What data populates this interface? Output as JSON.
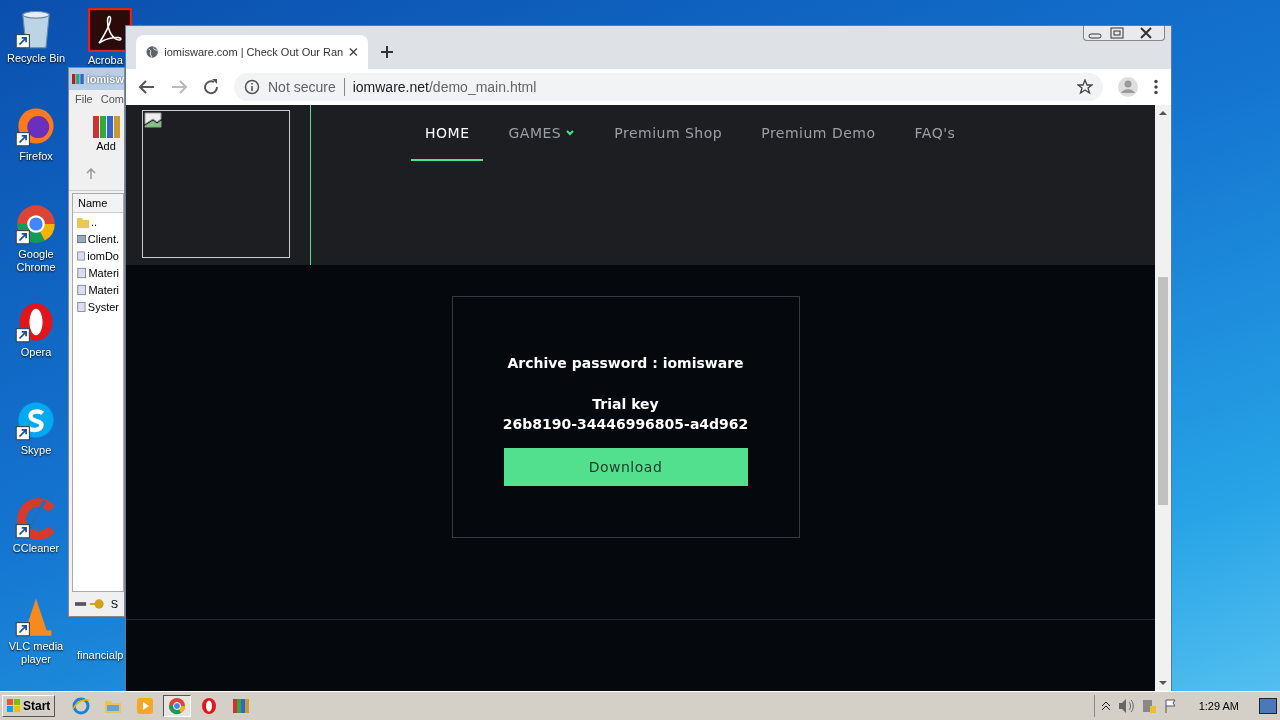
{
  "desktop": {
    "icons": [
      {
        "label": "Recycle Bin",
        "kind": "recycle"
      },
      {
        "label": "Firefox",
        "kind": "firefox"
      },
      {
        "label": "Google Chrome",
        "kind": "chrome"
      },
      {
        "label": "Opera",
        "kind": "opera"
      },
      {
        "label": "Skype",
        "kind": "skype"
      },
      {
        "label": "CCleaner",
        "kind": "ccleaner"
      },
      {
        "label": "VLC media player",
        "kind": "vlc"
      }
    ],
    "icons_col2": [
      {
        "label": "Acroba"
      },
      {
        "label": "financialp"
      }
    ]
  },
  "archive_window": {
    "title": "iomisw",
    "menu": [
      "File",
      "Com"
    ],
    "toolbar_button": "Add",
    "column": "Name",
    "files": [
      {
        "name": "..",
        "kind": "folder"
      },
      {
        "name": "Client.",
        "kind": "exe"
      },
      {
        "name": "iomDo",
        "kind": "dll"
      },
      {
        "name": "Materi",
        "kind": "dll"
      },
      {
        "name": "Materi",
        "kind": "dll"
      },
      {
        "name": "Syster",
        "kind": "dll"
      }
    ],
    "status": "S"
  },
  "browser": {
    "tab": {
      "title": "iomisware.com | Check Out Our Ran"
    },
    "security": "Not secure",
    "url_host": "iomware.net",
    "url_path": "/demo_main.html",
    "site": {
      "nav": [
        {
          "label": "HOME",
          "selected": true,
          "dropdown": false
        },
        {
          "label": "GAMES",
          "selected": false,
          "dropdown": true
        },
        {
          "label": "Premium Shop",
          "selected": false,
          "dropdown": false
        },
        {
          "label": "Premium Demo",
          "selected": false,
          "dropdown": false
        },
        {
          "label": "FAQ's",
          "selected": false,
          "dropdown": false
        }
      ],
      "card": {
        "password_line": "Archive password : iomisware",
        "key_label": "Trial key",
        "key": "26b8190-34446996805-a4d962",
        "button": "Download"
      }
    }
  },
  "taskbar": {
    "start": "Start",
    "apps": [
      {
        "kind": "ie",
        "selected": false
      },
      {
        "kind": "explorer",
        "selected": false
      },
      {
        "kind": "media",
        "selected": false
      },
      {
        "kind": "chrome",
        "selected": true
      },
      {
        "kind": "opera",
        "selected": false
      },
      {
        "kind": "winrar",
        "selected": false
      }
    ],
    "time": "1:29 AM"
  }
}
